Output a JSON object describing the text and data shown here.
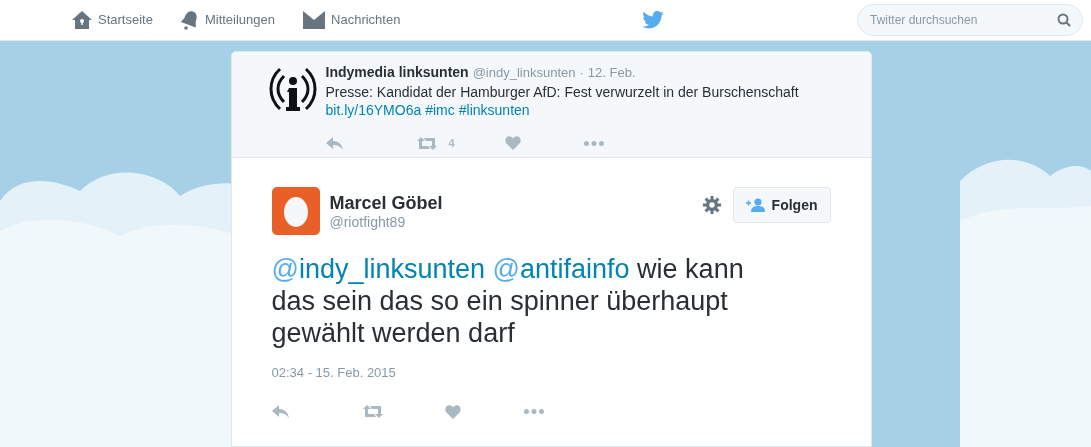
{
  "nav": [
    {
      "kind": "home",
      "label": "Startseite"
    },
    {
      "kind": "bell",
      "label": "Mitteilungen"
    },
    {
      "kind": "mail",
      "label": "Nachrichten"
    }
  ],
  "search": {
    "placeholder": "Twitter durchsuchen"
  },
  "parent_tweet": {
    "name": "Indymedia linksunten",
    "handle": "@indy_linksunten",
    "separator": "·",
    "date": "12. Feb.",
    "text": "Presse: Kandidat der Hamburger AfD: Fest verwurzelt in der Burschenschaft",
    "links": [
      "bit.ly/16YMO6a",
      "#imc",
      "#linksunten"
    ],
    "retweet_count": "4"
  },
  "tweet": {
    "name": "Marcel Göbel",
    "handle": "@riotfight89",
    "follow_label": "Folgen",
    "parts": [
      {
        "kind": "mention",
        "text": "@indy_linksunten"
      },
      {
        "kind": "mention",
        "text": "@antifainfo"
      },
      {
        "kind": "text",
        "text": " wie kann das sein das so ein spinner überhaupt gewählt werden darf"
      }
    ],
    "timestamp": "02:34 - 15. Feb. 2015"
  }
}
